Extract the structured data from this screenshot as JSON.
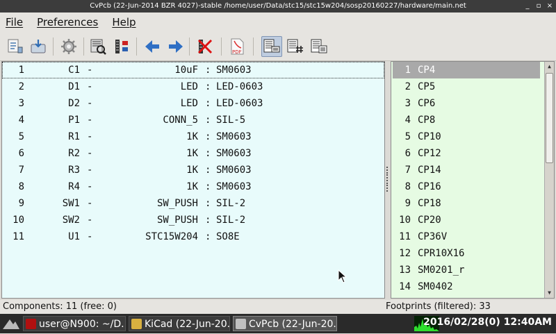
{
  "window": {
    "title": "CvPcb (22-Jun-2014 BZR 4027)-stable /home/user/Data/stc15/stc15w204/sosp20160227/hardware/main.net",
    "controls": [
      "_",
      "▫",
      "×"
    ]
  },
  "menu": {
    "file": "File",
    "preferences": "Preferences",
    "help": "Help"
  },
  "toolbar": {
    "icons": [
      "save-netlist-icon",
      "export-icon",
      "config-icon",
      "view-footprint-icon",
      "auto-associate-icon",
      "prev-icon",
      "next-icon",
      "delete-associations-icon",
      "pdf-doc-icon",
      "filter-by-keyword-icon",
      "filter-by-pins-icon",
      "filter-by-library-icon"
    ],
    "pdf_label": "PDF"
  },
  "components": [
    {
      "num": "1",
      "ref": "C1",
      "dash": "-",
      "value": "10uF",
      "colon": ":",
      "footprint": "SM0603"
    },
    {
      "num": "2",
      "ref": "D1",
      "dash": "-",
      "value": "LED",
      "colon": ":",
      "footprint": "LED-0603"
    },
    {
      "num": "3",
      "ref": "D2",
      "dash": "-",
      "value": "LED",
      "colon": ":",
      "footprint": "LED-0603"
    },
    {
      "num": "4",
      "ref": "P1",
      "dash": "-",
      "value": "CONN_5",
      "colon": ":",
      "footprint": "SIL-5"
    },
    {
      "num": "5",
      "ref": "R1",
      "dash": "-",
      "value": "1K",
      "colon": ":",
      "footprint": "SM0603"
    },
    {
      "num": "6",
      "ref": "R2",
      "dash": "-",
      "value": "1K",
      "colon": ":",
      "footprint": "SM0603"
    },
    {
      "num": "7",
      "ref": "R3",
      "dash": "-",
      "value": "1K",
      "colon": ":",
      "footprint": "SM0603"
    },
    {
      "num": "8",
      "ref": "R4",
      "dash": "-",
      "value": "1K",
      "colon": ":",
      "footprint": "SM0603"
    },
    {
      "num": "9",
      "ref": "SW1",
      "dash": "-",
      "value": "SW_PUSH",
      "colon": ":",
      "footprint": "SIL-2"
    },
    {
      "num": "10",
      "ref": "SW2",
      "dash": "-",
      "value": "SW_PUSH",
      "colon": ":",
      "footprint": "SIL-2"
    },
    {
      "num": "11",
      "ref": "U1",
      "dash": "-",
      "value": "STC15W204",
      "colon": ":",
      "footprint": "SO8E"
    }
  ],
  "footprints": [
    {
      "num": "1",
      "name": "CP4"
    },
    {
      "num": "2",
      "name": "CP5"
    },
    {
      "num": "3",
      "name": "CP6"
    },
    {
      "num": "4",
      "name": "CP8"
    },
    {
      "num": "5",
      "name": "CP10"
    },
    {
      "num": "6",
      "name": "CP12"
    },
    {
      "num": "7",
      "name": "CP14"
    },
    {
      "num": "8",
      "name": "CP16"
    },
    {
      "num": "9",
      "name": "CP18"
    },
    {
      "num": "10",
      "name": "CP20"
    },
    {
      "num": "11",
      "name": "CP36V"
    },
    {
      "num": "12",
      "name": "CPR10X16"
    },
    {
      "num": "13",
      "name": "SM0201_r"
    },
    {
      "num": "14",
      "name": "SM0402"
    }
  ],
  "status": {
    "components": "Components: 11 (free: 0)",
    "footprints": "Footprints (filtered): 33"
  },
  "taskbar": {
    "tasks": [
      {
        "label": "user@N900: ~/D...",
        "icon_color": "#b01010"
      },
      {
        "label": "KiCad (22-Jun-20...",
        "icon_color": "#d8b040"
      },
      {
        "label": "CvPcb (22-Jun-20...",
        "icon_color": "#c0c0c0"
      }
    ],
    "clock": "2016/02/28(0) 12:40AM"
  }
}
